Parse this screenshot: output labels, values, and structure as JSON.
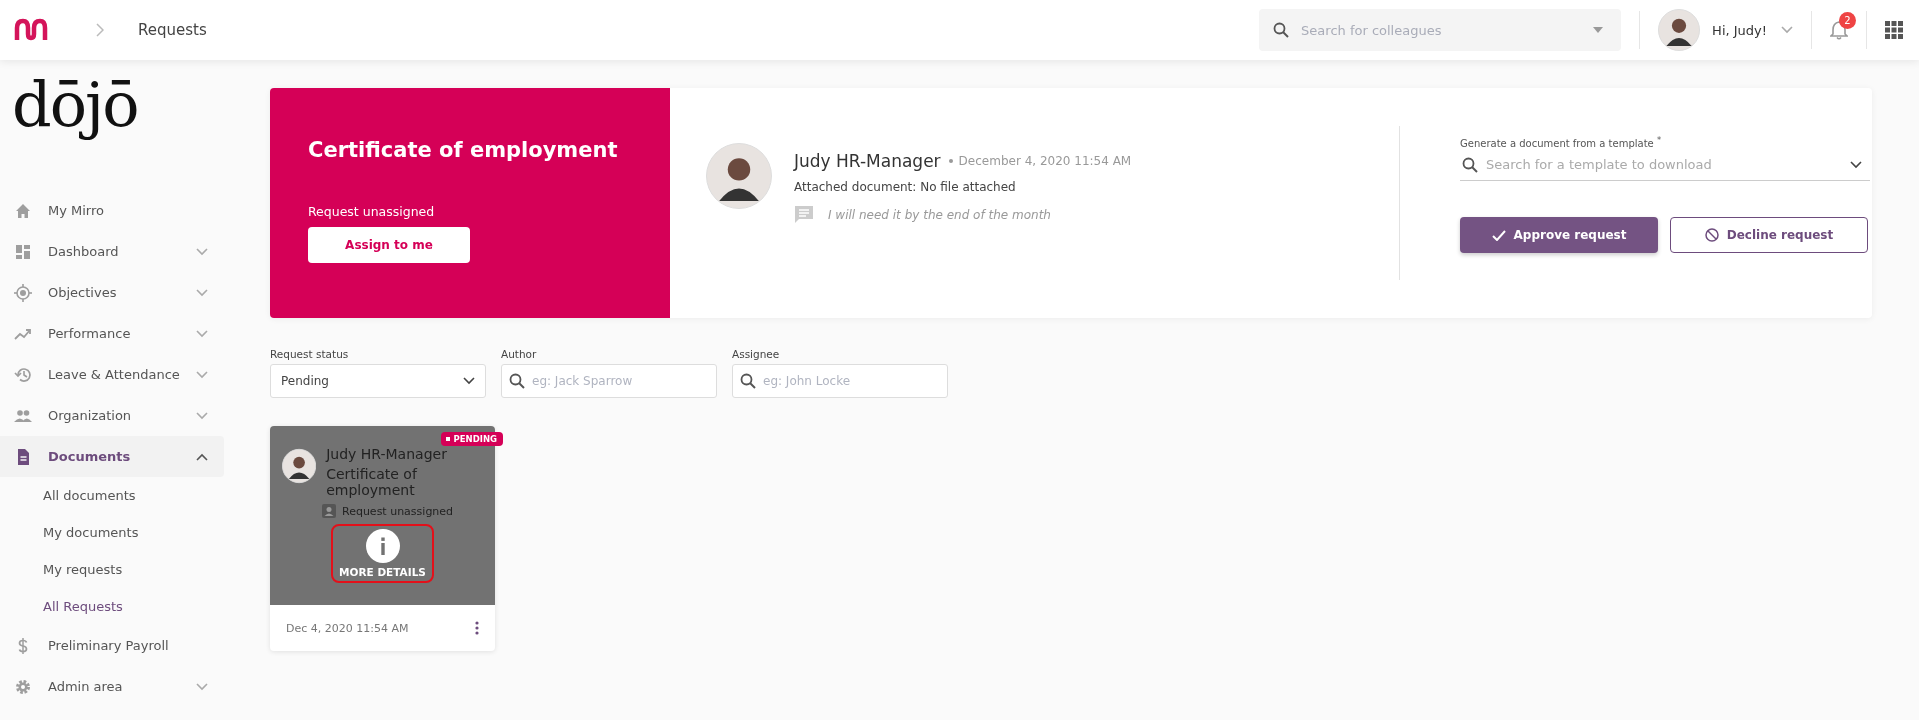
{
  "topbar": {
    "breadcrumb": "Requests",
    "search": {
      "placeholder": "Search for colleagues"
    },
    "greeting": "Hi, Judy!",
    "notifications": "2"
  },
  "sidebar": {
    "logo": "dōjō",
    "items": [
      {
        "label": "My Mirro",
        "kind": "link",
        "selected": false
      },
      {
        "label": "Dashboard",
        "kind": "group",
        "expanded": false,
        "selected": false
      },
      {
        "label": "Objectives",
        "kind": "group",
        "expanded": false,
        "selected": false
      },
      {
        "label": "Performance",
        "kind": "group",
        "expanded": false,
        "selected": false
      },
      {
        "label": "Leave & Attendance",
        "kind": "group",
        "expanded": false,
        "selected": false
      },
      {
        "label": "Organization",
        "kind": "group",
        "expanded": false,
        "selected": false
      },
      {
        "label": "Documents",
        "kind": "group",
        "expanded": true,
        "selected": true,
        "children": [
          {
            "label": "All documents",
            "selected": false
          },
          {
            "label": "My documents",
            "selected": false
          },
          {
            "label": "My requests",
            "selected": false
          },
          {
            "label": "All Requests",
            "selected": true
          }
        ]
      },
      {
        "label": "Preliminary Payroll",
        "kind": "link",
        "selected": false
      },
      {
        "label": "Admin area",
        "kind": "group",
        "expanded": false,
        "selected": false
      }
    ]
  },
  "request": {
    "title": "Certificate of employment",
    "assignment": "Request unassigned",
    "assign_button": "Assign to me",
    "author": "Judy HR-Manager",
    "date": "December 4, 2020 11:54 AM",
    "attachment": "Attached document: No file attached",
    "comment": "I will need it by the end of the month",
    "template": {
      "label": "Generate a document from a template $^{*}$",
      "placeholder": "Search for a template to download"
    },
    "buttons": [
      {
        "label": "Approve request",
        "kind": "primary"
      },
      {
        "label": "Decline request",
        "kind": "secondary"
      }
    ]
  },
  "filters": [
    {
      "label": "Request status",
      "kind": "select",
      "value": "Pending"
    },
    {
      "label": "Author",
      "kind": "search",
      "placeholder": "eg: Jack Sparrow"
    },
    {
      "label": "Assignee",
      "kind": "search",
      "placeholder": "eg: John Locke"
    }
  ],
  "cards": [
    {
      "author": "Judy HR-Manager",
      "title": "Certificate of employment",
      "assignment": "Request unassigned",
      "status": "PENDING",
      "date": "Dec 4, 2020 11:54 AM",
      "hovered": true,
      "overlay_label": "MORE DETAILS"
    }
  ]
}
